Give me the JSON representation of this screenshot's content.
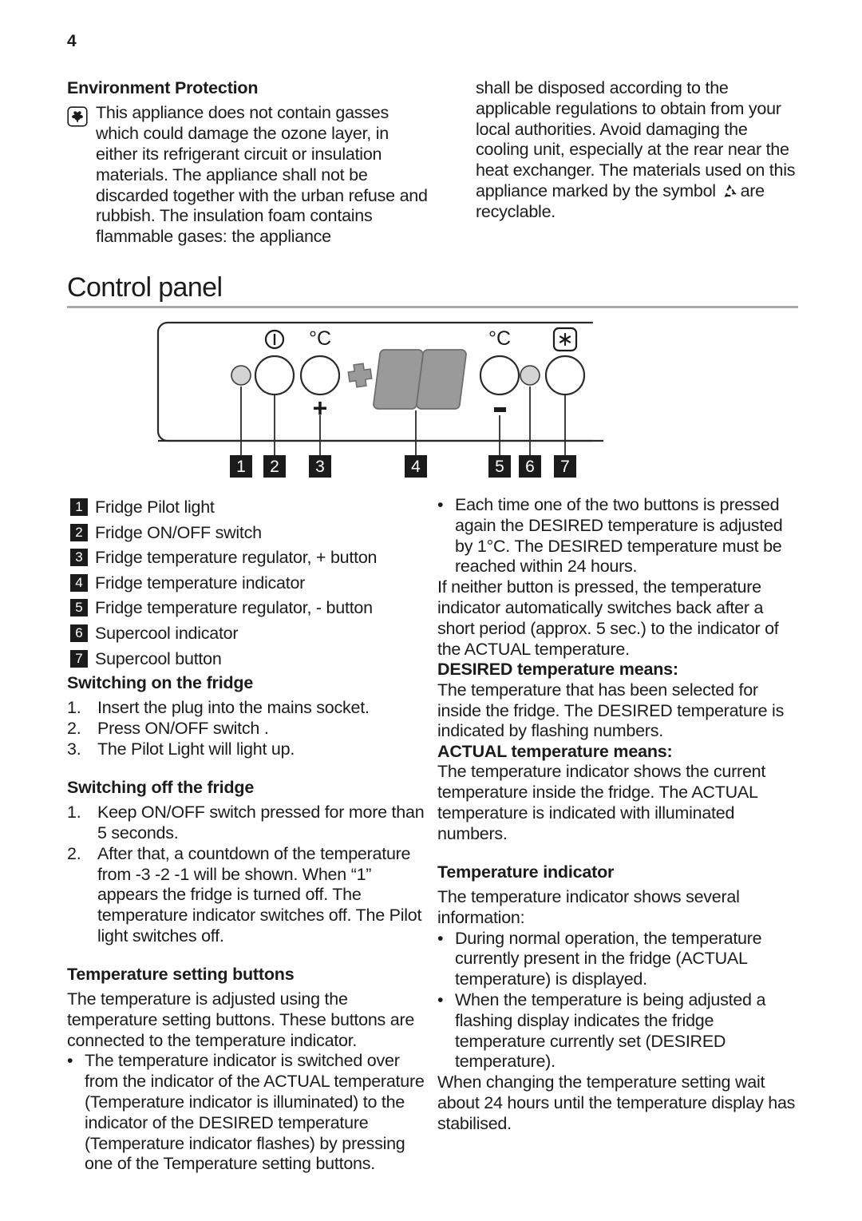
{
  "page": {
    "number": "4"
  },
  "environment": {
    "heading": "Environment Protection",
    "icon_name": "eco-flower-icon",
    "body_left": "This appliance does not contain gasses which could damage the ozone layer, in either its refrigerant circuit or insulation materials. The appliance shall not be discarded together with the urban refuse and rubbish. The insulation foam contains flammable gases: the appliance",
    "body_right_before_symbol": "shall be disposed according to the applicable regulations to obtain from your local authorities. Avoid damaging the cooling unit, especially at the rear near the heat exchanger. The materials used on this appliance marked by the symbol",
    "recycle_icon_name": "recycle-icon",
    "body_right_after_symbol": "are recyclable."
  },
  "control_panel": {
    "heading": "Control panel",
    "diagram": {
      "power_symbol": "Ⓘ",
      "celsius_left": "°C",
      "celsius_right": "°C",
      "snowflake_symbol": "✱",
      "plus_large": "+",
      "plus_small": "+",
      "minus_small": "-",
      "callouts": [
        "1",
        "2",
        "3",
        "4",
        "5",
        "6",
        "7"
      ]
    },
    "legend": [
      {
        "num": "1",
        "label": "Fridge Pilot light"
      },
      {
        "num": "2",
        "label": "Fridge ON/OFF switch"
      },
      {
        "num": "3",
        "label": "Fridge temperature regulator, + button"
      },
      {
        "num": "4",
        "label": "Fridge temperature indicator"
      },
      {
        "num": "5",
        "label": "Fridge temperature regulator, - button"
      },
      {
        "num": "6",
        "label": "Supercool indicator"
      },
      {
        "num": "7",
        "label": "Supercool button"
      }
    ]
  },
  "switching_on": {
    "heading": "Switching on the fridge",
    "steps": [
      {
        "marker": "1.",
        "text": "Insert the plug into the mains socket."
      },
      {
        "marker": "2.",
        "text": "Press ON/OFF switch ."
      },
      {
        "marker": "3.",
        "text": "The Pilot Light will light up."
      }
    ]
  },
  "switching_off": {
    "heading": "Switching off the fridge",
    "steps": [
      {
        "marker": "1.",
        "text": "Keep ON/OFF switch pressed for more than 5 seconds."
      },
      {
        "marker": "2.",
        "text": "After that, a countdown of the temperature from -3 -2 -1 will be shown. When “1” appears the fridge is turned off. The temperature indicator switches off. The Pilot light switches off."
      }
    ]
  },
  "temp_setting_buttons": {
    "heading": "Temperature setting buttons",
    "intro": "The temperature is adjusted using the temperature setting buttons. These buttons are connected to the temperature indicator.",
    "bullets": [
      "The temperature indicator is switched over from the indicator of the ACTUAL temperature (Temperature indicator is illuminated) to the indicator of the DESIRED temperature (Temperature indicator flashes) by pressing one of the Temperature setting buttons."
    ]
  },
  "right_column": {
    "top_bullet": "Each time one of the two buttons is pressed again the DESIRED temperature is adjusted by 1°C. The DESIRED temperature must be reached within 24 hours.",
    "top_paragraph": "If neither button is pressed, the temperature indicator automatically switches back after a short period (approx. 5 sec.) to the indicator of the ACTUAL temperature.",
    "desired_heading": "DESIRED temperature means:",
    "desired_body": "The temperature that has been selected for inside the fridge. The DESIRED temperature is indicated by flashing numbers.",
    "actual_heading": "ACTUAL temperature means:",
    "actual_body": "The temperature indicator shows the current temperature inside the fridge. The ACTUAL temperature is indicated with illuminated numbers.",
    "indicator_heading": "Temperature indicator",
    "indicator_intro": "The temperature indicator shows several information:",
    "indicator_bullets": [
      "During normal operation, the temperature currently present in the fridge (ACTUAL temperature) is displayed.",
      "When the temperature is being adjusted a flashing display indicates the fridge temperature currently set (DESIRED temperature)."
    ],
    "closing_paragraph": "When changing the temperature setting wait about 24 hours until the temperature display has stabilised."
  },
  "bullet_char": "•",
  "colors": {
    "text": "#1b1b1b",
    "rule": "#a9a9a9",
    "badge_bg": "#1b1b1b",
    "badge_text": "#ffffff",
    "panel_fill": "#9a9a9a",
    "pilot_fill": "#d4d4d4",
    "outline": "#2a2a2a"
  }
}
